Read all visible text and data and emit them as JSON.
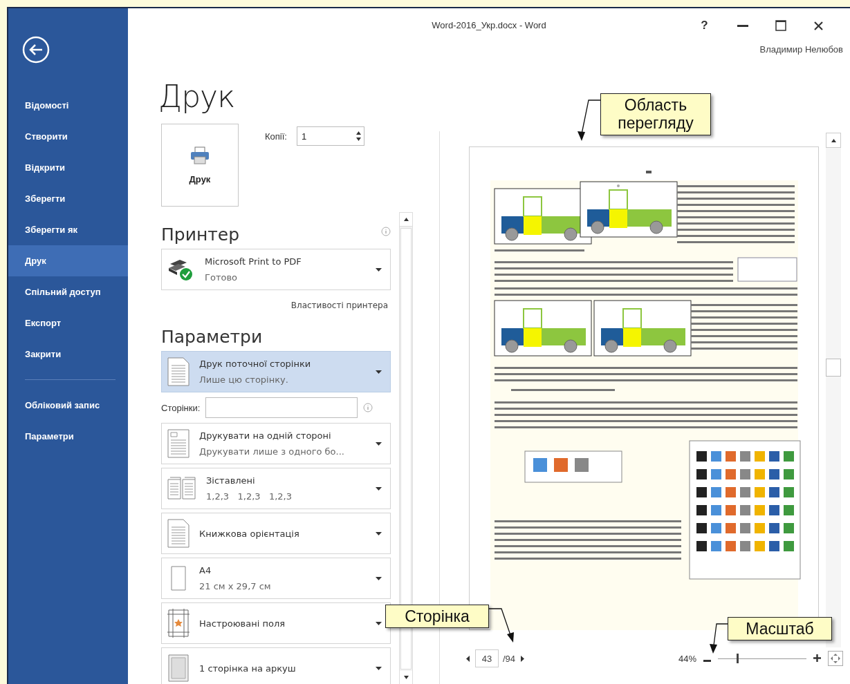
{
  "window": {
    "title": "Word-2016_Укр.docx - Word",
    "help": "?",
    "user": "Владимир Нелюбов"
  },
  "sidebar": {
    "items": [
      {
        "label": "Відомості",
        "selected": false
      },
      {
        "label": "Створити",
        "selected": false
      },
      {
        "label": "Відкрити",
        "selected": false
      },
      {
        "label": "Зберегти",
        "selected": false
      },
      {
        "label": "Зберегти як",
        "selected": false
      },
      {
        "label": "Друк",
        "selected": true
      },
      {
        "label": "Спільний доступ",
        "selected": false
      },
      {
        "label": "Експорт",
        "selected": false
      },
      {
        "label": "Закрити",
        "selected": false
      }
    ],
    "footer_items": [
      {
        "label": "Обліковий запис",
        "selected": false
      },
      {
        "label": "Параметри",
        "selected": false
      }
    ]
  },
  "print": {
    "title": "Друк",
    "button": "Друк",
    "copies_label": "Копії:",
    "copies_value": "1"
  },
  "printer": {
    "heading": "Принтер",
    "name": "Microsoft Print to PDF",
    "status": "Готово",
    "properties_link": "Властивості принтера"
  },
  "settings": {
    "heading": "Параметри",
    "rows": [
      {
        "kind": "dropdown",
        "title": "Друк поточної сторінки",
        "subtitle": "Лише цю сторінку.",
        "selected": true
      },
      {
        "kind": "field",
        "label": "Сторінки:"
      },
      {
        "kind": "dropdown",
        "title": "Друкувати на одній стороні",
        "subtitle": "Друкувати лише з одного бо...",
        "selected": false
      },
      {
        "kind": "dropdown",
        "title": "Зіставлені",
        "subtitle": "1,2,3   1,2,3   1,2,3",
        "selected": false
      },
      {
        "kind": "dropdown",
        "title": "Книжкова орієнтація",
        "selected": false
      },
      {
        "kind": "dropdown",
        "title": "A4",
        "subtitle": "21 см x 29,7 см",
        "selected": false
      },
      {
        "kind": "dropdown",
        "title": "Настроювані поля",
        "selected": false
      },
      {
        "kind": "dropdown",
        "title": "1 сторінка на аркуш",
        "selected": false
      }
    ]
  },
  "preview": {
    "page_current": "43",
    "page_total": "/94",
    "zoom_reading": "44%",
    "zoom": {
      "level": 0.22
    }
  },
  "callouts": [
    {
      "text": "Область перегляду"
    },
    {
      "text": "Сторінка"
    },
    {
      "text": "Масштаб"
    }
  ]
}
